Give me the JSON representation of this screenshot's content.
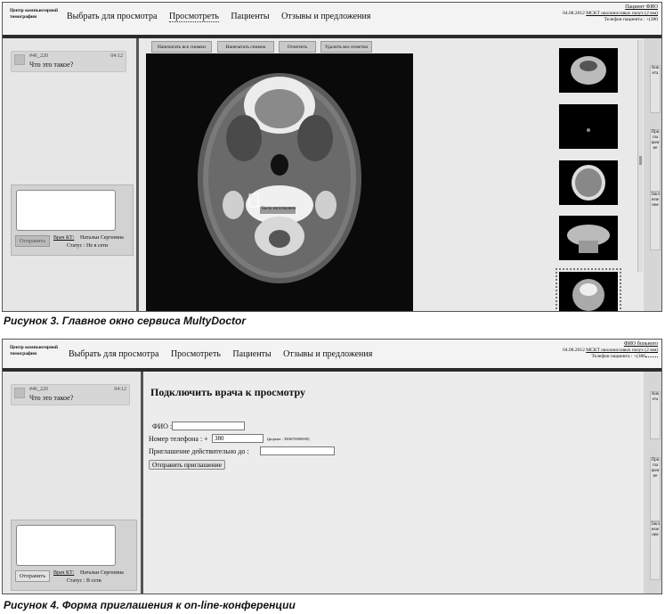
{
  "screens": [
    {
      "logo": "Центр компьютерной томографии",
      "nav": [
        "Выбрать для просмотра",
        "Просмотреть",
        "Пациенты",
        "Отзывы и предложения"
      ],
      "nav_active": 1,
      "patient": {
        "name": "Пациент ФИО",
        "date": "04.08.2012",
        "study": "МСКТ околоносовых пазух (2 мм)",
        "phone_label": "Телефон пациента :",
        "phone": "+(380"
      },
      "message": {
        "from": "#46_220",
        "time": "04:12",
        "text": "Что это такое?"
      },
      "compose": {
        "send": "Отправить",
        "doctor_label": "Врач КТ:",
        "doctor_name": "Натальи Сергеевна",
        "status": "Статус : Не в сети"
      },
      "toolbar": [
        "Напечатать все снимки",
        "Напечатать снимок",
        "Отметить",
        "Удалить все отметки"
      ],
      "annotation": "Было изготовлено",
      "side_tabs": [
        "Анкета",
        "Приглашение",
        "Заключение"
      ]
    },
    {
      "logo": "Центр компьютерной томографии",
      "nav": [
        "Выбрать для просмотра",
        "Просмотреть",
        "Пациенты",
        "Отзывы и предложения"
      ],
      "patient": {
        "name": "ФИО больного",
        "date": "04.08.2012",
        "study": "МСКТ околоносовых пазух (2 мм)",
        "phone_label": "Телефон пациента :",
        "phone": "+(380"
      },
      "message": {
        "from": "#46_220",
        "time": "04:12",
        "text": "Что это такое?"
      },
      "compose": {
        "send": "Отправить",
        "doctor_label": "Врач КТ:",
        "doctor_name": "Натальи Сергеевна",
        "status": "Статус : В сети"
      },
      "form": {
        "title": "Подключить врача к просмотру",
        "fio_label": "ФИО :",
        "phone_label": "Номер телефона : +",
        "phone_value": "380",
        "phone_hint": "(формат : 380670000000)",
        "valid_label": "Приглашение действительно до :",
        "submit": "Отправить приглашение"
      },
      "side_tabs": [
        "Анкета",
        "Приглашение",
        "Заключение"
      ]
    }
  ],
  "captions": [
    "Рисунок 3. Главное окно сервиса MultyDoctor",
    "Рисунок 4. Форма приглашения к on-line-конференции"
  ]
}
